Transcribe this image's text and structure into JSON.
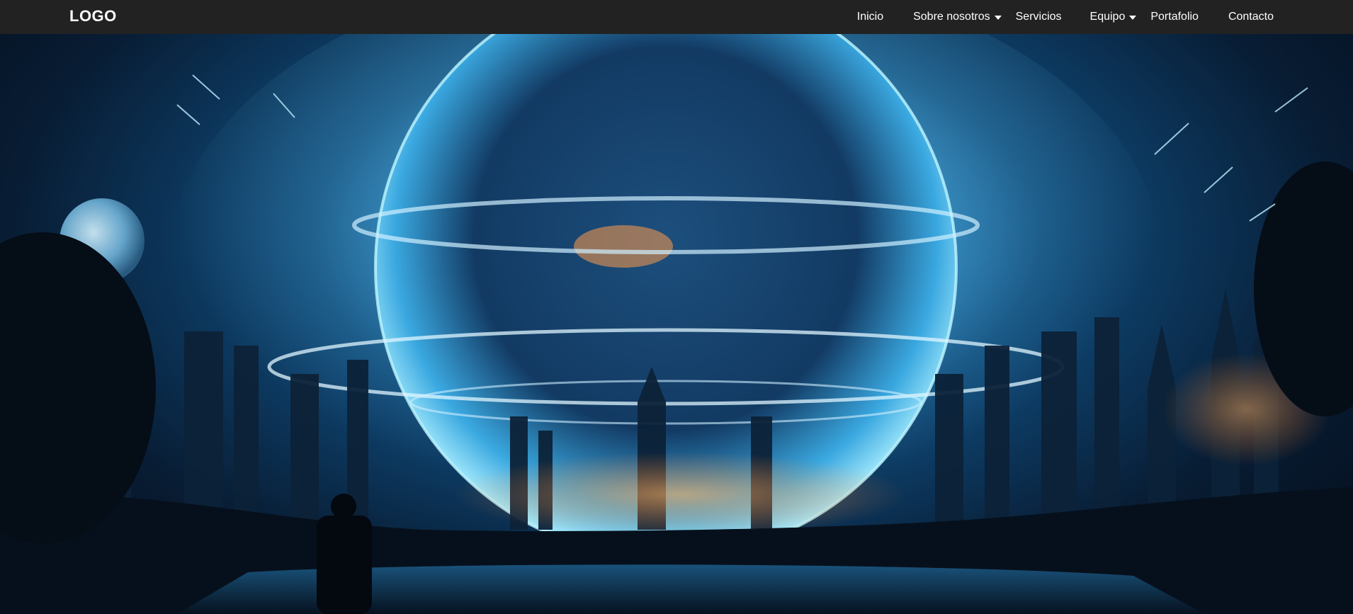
{
  "navbar": {
    "logo": "LOGO",
    "items": [
      {
        "label": "Inicio",
        "dropdown": false
      },
      {
        "label": "Sobre nosotros",
        "dropdown": true
      },
      {
        "label": "Servicios",
        "dropdown": false
      },
      {
        "label": "Equipo",
        "dropdown": true
      },
      {
        "label": "Portafolio",
        "dropdown": false
      },
      {
        "label": "Contacto",
        "dropdown": false
      }
    ]
  },
  "hero": {
    "scene": "futuristic-city-planet-background"
  },
  "colors": {
    "navbar_bg": "#222222",
    "nav_text": "#ffffff",
    "glow": "#6fd3ff"
  }
}
